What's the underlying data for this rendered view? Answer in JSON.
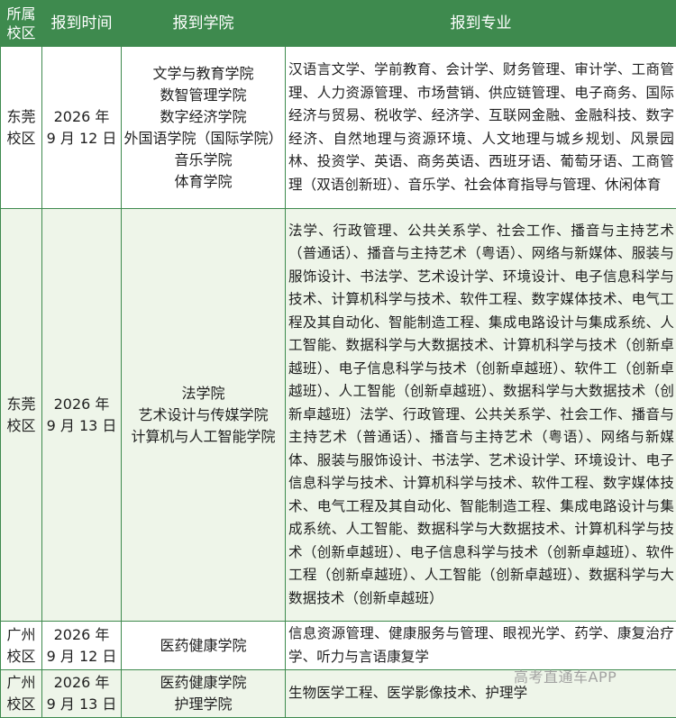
{
  "headers": {
    "campus_line1": "所属",
    "campus_line2": "校区",
    "date": "报到时间",
    "college": "报到学院",
    "major": "报到专业"
  },
  "rows": [
    {
      "campus": [
        "东莞",
        "校区"
      ],
      "date": [
        "2026 年",
        "9 月 12 日"
      ],
      "colleges": [
        "文学与教育学院",
        "数智管理学院",
        "数字经济学院",
        "外国语学院（国际学院）",
        "音乐学院",
        "体育学院"
      ],
      "majors": "汉语言文学、学前教育、会计学、财务管理、审计学、工商管理、人力资源管理、市场营销、供应链管理、电子商务、国际经济与贸易、税收学、经济学、互联网金融、金融科技、数字经济、自然地理与资源环境、人文地理与城乡规划、风景园林、投资学、英语、商务英语、西班牙语、葡萄牙语、工商管理（双语创新班）、音乐学、社会体育指导与管理、休闲体育"
    },
    {
      "campus": [
        "东莞",
        "校区"
      ],
      "date": [
        "2026 年",
        "9 月 13 日"
      ],
      "colleges": [
        "法学院",
        "艺术设计与传媒学院",
        "计算机与人工智能学院"
      ],
      "majors": "法学、行政管理、公共关系学、社会工作、播音与主持艺术（普通话）、播音与主持艺术（粤语）、网络与新媒体、服装与服饰设计、书法学、艺术设计学、环境设计、电子信息科学与技术、计算机科学与技术、软件工程、数字媒体技术、电气工程及其自动化、智能制造工程、集成电路设计与集成系统、人工智能、数据科学与大数据技术、计算机科学与技术（创新卓越班）、电子信息科学与技术（创新卓越班）、软件工（创新卓越班）、人工智能（创新卓越班）、数据科学与大数据技术（创新卓越班）法学、行政管理、公共关系学、社会工作、播音与主持艺术（普通话）、播音与主持艺术（粤语）、网络与新媒体、服装与服饰设计、书法学、艺术设计学、环境设计、电子信息科学与技术、计算机科学与技术、软件工程、数字媒体技术、电气工程及其自动化、智能制造工程、集成电路设计与集成系统、人工智能、数据科学与大数据技术、计算机科学与技术（创新卓越班）、电子信息科学与技术（创新卓越班）、软件工程（创新卓越班）、人工智能（创新卓越班）、数据科学与大数据技术（创新卓越班）"
    },
    {
      "campus": [
        "广州",
        "校区"
      ],
      "date": [
        "2026 年",
        "9 月 12 日"
      ],
      "colleges": [
        "医药健康学院"
      ],
      "majors": "信息资源管理、健康服务与管理、眼视光学、药学、康复治疗学、听力与言语康复学"
    },
    {
      "campus": [
        "广州",
        "校区"
      ],
      "date": [
        "2026 年",
        "9 月 13 日"
      ],
      "colleges": [
        "医药健康学院",
        "护理学院"
      ],
      "majors": "生物医学工程、医学影像技术、护理学"
    }
  ],
  "watermark": "高考直通车APP",
  "colors": {
    "header_bg": "#3e8a4e",
    "zebra_bg": "#eef5e9",
    "border": "#3e8a4e"
  }
}
